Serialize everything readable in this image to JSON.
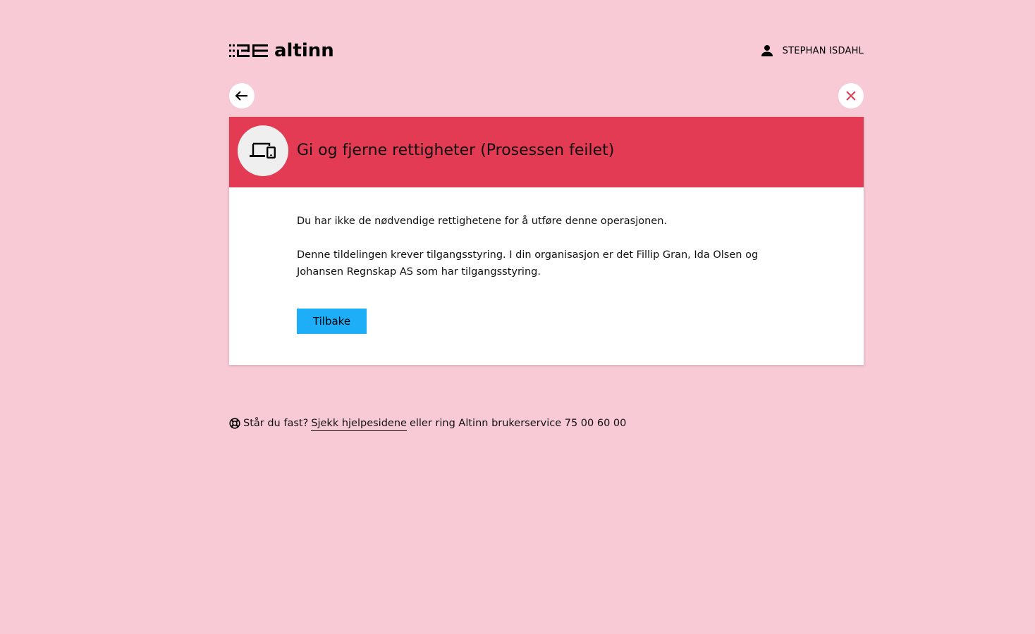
{
  "header": {
    "logo_text": "altinn",
    "user_name": "STEPHAN ISDAHL"
  },
  "nav": {
    "back_icon": "arrow-left-icon",
    "close_icon": "close-icon"
  },
  "card": {
    "icon": "devices-icon",
    "title": "Gi og fjerne rettigheter (Prosessen feilet)",
    "paragraph1": "Du har ikke de nødvendige rettighetene for å utføre denne operasjonen.",
    "paragraph2": "Denne tildelingen krever tilgangsstyring. I din organisasjon er det Fillip Gran, Ida Olsen og Johansen Regnskap AS som har tilgangsstyring.",
    "button_label": "Tilbake"
  },
  "help": {
    "prefix": "Står du fast?",
    "link_text": "Sjekk hjelpesidene",
    "suffix": "eller ring Altinn brukerservice 75 00 60 00"
  },
  "colors": {
    "background": "#f8cad5",
    "header_red": "#e23b53",
    "button_blue": "#1eaef7",
    "close_red": "#e23b53"
  }
}
